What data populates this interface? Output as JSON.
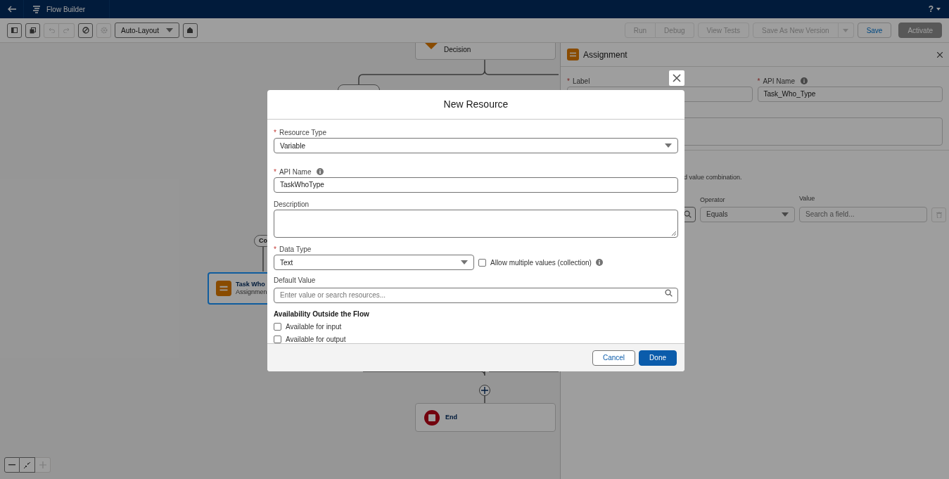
{
  "header": {
    "title": "Flow Builder",
    "help": "?"
  },
  "toolbar": {
    "layout_menu": "Auto-Layout",
    "buttons": [
      {
        "label": "Run",
        "disabled": true
      },
      {
        "label": "Debug",
        "disabled": true
      },
      {
        "label": "View Tests",
        "disabled": true
      },
      {
        "label": "Save As New Version",
        "disabled": true
      },
      {
        "label": "Save",
        "disabled": false
      },
      {
        "label": "Activate",
        "disabled": true
      }
    ]
  },
  "canvas": {
    "nodes": [
      {
        "kind": "decision",
        "title": "Decision",
        "selected": false
      },
      {
        "kind": "assignment",
        "title": "Task Who",
        "subtitle": "Assignmen",
        "selected": true
      },
      {
        "kind": "end",
        "title": "End",
        "selected": false
      }
    ],
    "path_labels": [
      "Co"
    ]
  },
  "panel": {
    "title": "Assignment",
    "label_field": {
      "marker": "*",
      "label": "Label"
    },
    "api_name_field": {
      "marker": "*",
      "label": "API Name",
      "value": "Task_Who_Type"
    },
    "hint": "d value combination.",
    "operator": {
      "label": "Operator",
      "value": "Equals"
    },
    "value": {
      "label": "Value",
      "placeholder": "Search a field..."
    }
  },
  "modal": {
    "title": "New Resource",
    "resource_type": {
      "marker": "*",
      "label": "Resource Type",
      "value": "Variable"
    },
    "api_name": {
      "marker": "*",
      "label": "API Name",
      "value": "TaskWhoType"
    },
    "description": {
      "label": "Description"
    },
    "data_type": {
      "marker": "*",
      "label": "Data Type",
      "value": "Text"
    },
    "allow_multiple": {
      "label": "Allow multiple values (collection)",
      "checked": false
    },
    "default_value": {
      "label": "Default Value",
      "placeholder": "Enter value or search resources..."
    },
    "availability": {
      "heading": "Availability Outside the Flow",
      "options": [
        {
          "label": "Available for input",
          "checked": false
        },
        {
          "label": "Available for output",
          "checked": false
        }
      ]
    },
    "buttons": [
      {
        "label": "Cancel",
        "kind": "neutral"
      },
      {
        "label": "Done",
        "kind": "brand"
      }
    ]
  }
}
